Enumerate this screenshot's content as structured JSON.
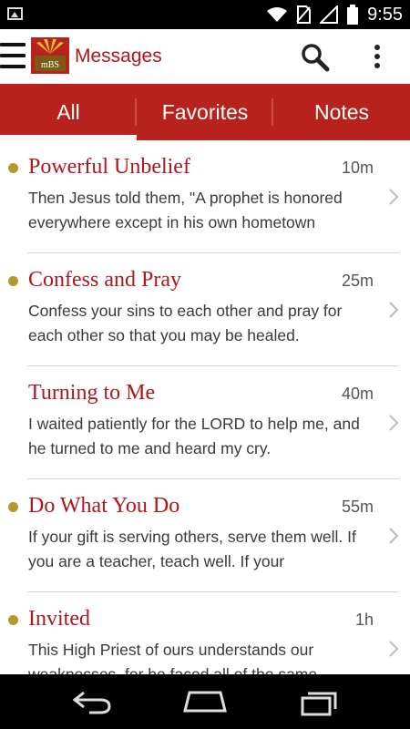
{
  "status_bar": {
    "time": "9:55",
    "icons": [
      "image-notification-icon",
      "wifi-icon",
      "no-sim-icon",
      "signal-icon",
      "battery-icon"
    ]
  },
  "action_bar": {
    "title": "Messages",
    "logo_text": "mBS",
    "icons": [
      "menu-icon",
      "app-logo",
      "search-icon",
      "overflow-menu-icon"
    ]
  },
  "tabs": [
    {
      "label": "All",
      "selected": true
    },
    {
      "label": "Favorites",
      "selected": false
    },
    {
      "label": "Notes",
      "selected": false
    }
  ],
  "messages": [
    {
      "title": "Powerful Unbelief",
      "time": "10m",
      "body": "Then Jesus told them, \"A prophet is honored everywhere except in his own hometown",
      "unread": true
    },
    {
      "title": "Confess and Pray",
      "time": "25m",
      "body": "Confess your sins to each other and pray for each other so that you may be healed.",
      "unread": true
    },
    {
      "title": "Turning to Me",
      "time": "40m",
      "body": "I waited patiently for the LORD to help me, and he turned to me and heard my cry.",
      "unread": false
    },
    {
      "title": "Do What You Do",
      "time": "55m",
      "body": "If your gift is serving others, serve them well. If you are a teacher, teach well. If your",
      "unread": true
    },
    {
      "title": "Invited",
      "time": "1h",
      "body": "This High Priest of ours understands our weaknesses, for he faced all of the same",
      "unread": true
    }
  ],
  "colors": {
    "brand_red": "#b7221d",
    "title_red": "#b0161b",
    "unread_dot": "#b5972b"
  },
  "nav_bar": {
    "icons": [
      "back-icon",
      "home-icon",
      "recent-apps-icon"
    ]
  }
}
